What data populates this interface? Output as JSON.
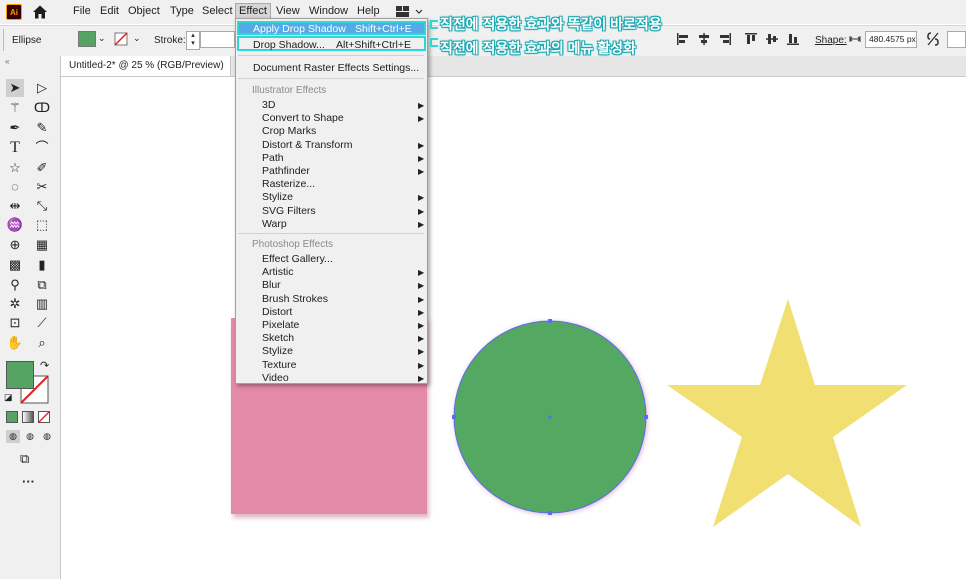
{
  "app": {
    "logo_text": "Ai"
  },
  "menubar": {
    "items": [
      "File",
      "Edit",
      "Object",
      "Type",
      "Select",
      "Effect",
      "View",
      "Window",
      "Help"
    ],
    "active": "Effect"
  },
  "controlbar": {
    "object_type": "Ellipse",
    "stroke_label": "Stroke:",
    "shape_label": "Shape:",
    "width_value": "480.4575 px",
    "fill_color": "#55a464"
  },
  "document": {
    "tab_title": "Untitled-2* @ 25 % (RGB/Preview)"
  },
  "effect_menu": {
    "apply_last": {
      "label": "Apply Drop Shadow",
      "shortcut": "Shift+Ctrl+E"
    },
    "last_effect": {
      "label": "Drop Shadow...",
      "shortcut": "Alt+Shift+Ctrl+E"
    },
    "raster_settings": "Document Raster Effects Settings...",
    "illustrator_header": "Illustrator Effects",
    "illustrator_items": [
      {
        "label": "3D",
        "submenu": true
      },
      {
        "label": "Convert to Shape",
        "submenu": true
      },
      {
        "label": "Crop Marks",
        "submenu": false
      },
      {
        "label": "Distort & Transform",
        "submenu": true
      },
      {
        "label": "Path",
        "submenu": true
      },
      {
        "label": "Pathfinder",
        "submenu": true
      },
      {
        "label": "Rasterize...",
        "submenu": false
      },
      {
        "label": "Stylize",
        "submenu": true
      },
      {
        "label": "SVG Filters",
        "submenu": true
      },
      {
        "label": "Warp",
        "submenu": true
      }
    ],
    "photoshop_header": "Photoshop Effects",
    "photoshop_items": [
      {
        "label": "Effect Gallery...",
        "submenu": false
      },
      {
        "label": "Artistic",
        "submenu": true
      },
      {
        "label": "Blur",
        "submenu": true
      },
      {
        "label": "Brush Strokes",
        "submenu": true
      },
      {
        "label": "Distort",
        "submenu": true
      },
      {
        "label": "Pixelate",
        "submenu": true
      },
      {
        "label": "Sketch",
        "submenu": true
      },
      {
        "label": "Stylize",
        "submenu": true
      },
      {
        "label": "Texture",
        "submenu": true
      },
      {
        "label": "Video",
        "submenu": true
      }
    ]
  },
  "annotations": {
    "apply": "직전에 적용한 효과와 똑같이 바로적용",
    "drop": "직전에 적용한 효과의 메뉴 활성화",
    "highlight_color": "#2ed6d6"
  },
  "canvas_shapes": {
    "rectangle_color": "#e48aa9",
    "circle_color": "#55a862",
    "star_color": "#f2df72",
    "selection_color": "#5a6cf0"
  },
  "toolbar": {
    "fill_swatch": "#55a464"
  }
}
